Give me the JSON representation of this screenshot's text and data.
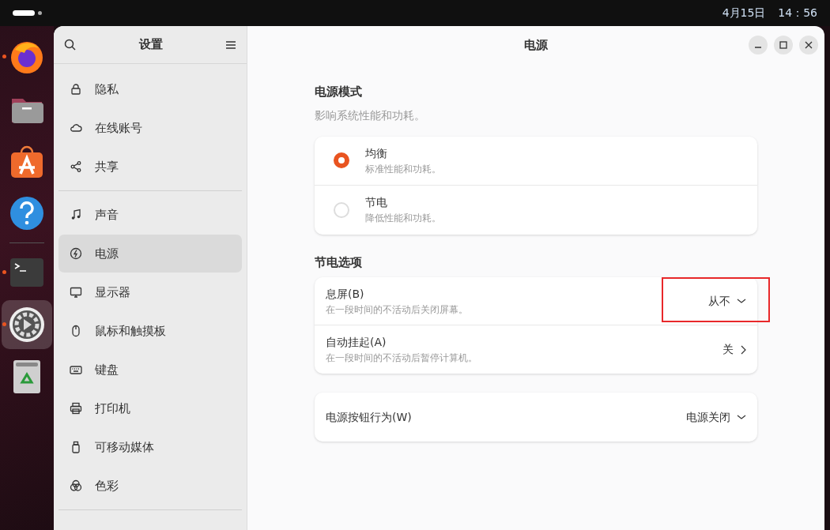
{
  "top_bar": {
    "date": "4月15日",
    "time": "14：56"
  },
  "dock": [
    {
      "running": true,
      "selected": false
    },
    {
      "running": false,
      "selected": false
    },
    {
      "running": false,
      "selected": false
    },
    {
      "running": false,
      "selected": false
    },
    {
      "running": true,
      "selected": false
    },
    {
      "running": true,
      "selected": true
    },
    {
      "running": false,
      "selected": false
    }
  ],
  "sidebar": {
    "title": "设置",
    "groups": [
      [
        {
          "label": "隐私",
          "selected": false
        },
        {
          "label": "在线账号",
          "selected": false
        },
        {
          "label": "共享",
          "selected": false
        }
      ],
      [
        {
          "label": "声音",
          "selected": false
        },
        {
          "label": "电源",
          "selected": true
        },
        {
          "label": "显示器",
          "selected": false
        },
        {
          "label": "鼠标和触摸板",
          "selected": false
        },
        {
          "label": "键盘",
          "selected": false
        },
        {
          "label": "打印机",
          "selected": false
        },
        {
          "label": "可移动媒体",
          "selected": false
        },
        {
          "label": "色彩",
          "selected": false
        }
      ]
    ]
  },
  "window": {
    "title": "电源"
  },
  "power_mode": {
    "title": "电源模式",
    "subtitle": "影响系统性能和功耗。",
    "options": [
      {
        "label": "均衡",
        "description": "标准性能和功耗。",
        "selected": true
      },
      {
        "label": "节电",
        "description": "降低性能和功耗。",
        "selected": false
      }
    ]
  },
  "power_saving": {
    "title": "节电选项",
    "rows": [
      {
        "kind": "dropdown",
        "label": "息屏(B)",
        "description": "在一段时间的不活动后关闭屏幕。",
        "value": "从不",
        "highlighted": true
      },
      {
        "kind": "link",
        "label": "自动挂起(A)",
        "description": "在一段时间的不活动后暂停计算机。",
        "value": "关",
        "highlighted": false
      }
    ]
  },
  "power_button": {
    "rows": [
      {
        "kind": "dropdown",
        "label": "电源按钮行为(W)",
        "value": "电源关闭",
        "highlighted": false
      }
    ]
  }
}
